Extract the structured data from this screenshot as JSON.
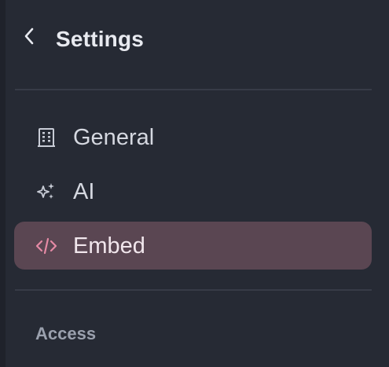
{
  "header": {
    "back_icon": "chevron-left-icon",
    "title": "Settings"
  },
  "nav": {
    "items": [
      {
        "label": "General",
        "icon": "building-icon",
        "active": false
      },
      {
        "label": "AI",
        "icon": "sparkles-icon",
        "active": false
      },
      {
        "label": "Embed",
        "icon": "code-icon",
        "active": true
      }
    ]
  },
  "sections": {
    "access_label": "Access"
  },
  "colors": {
    "background": "#262a34",
    "active_bg": "#5a4652",
    "accent": "#e58aa5",
    "text": "#d5d8e0"
  }
}
